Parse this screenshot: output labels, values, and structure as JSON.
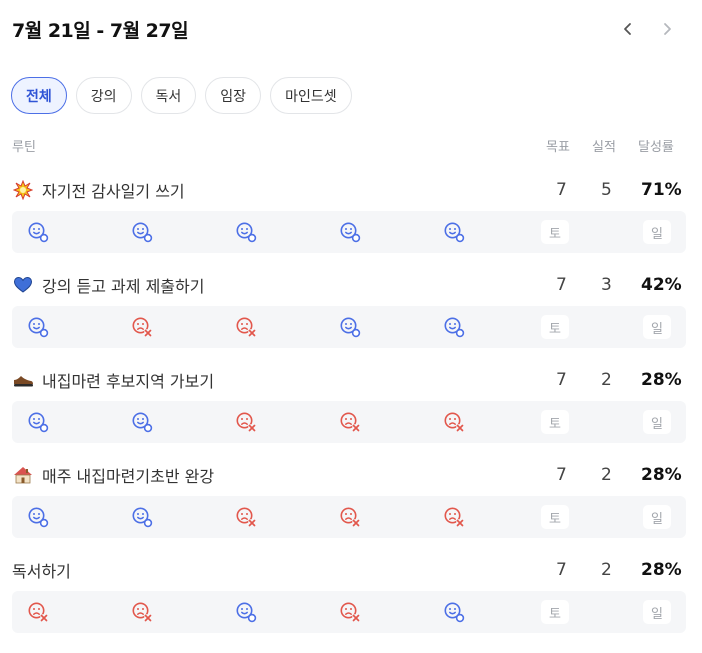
{
  "header": {
    "title": "7월 21일 - 7월 27일"
  },
  "tabs": [
    {
      "label": "전체",
      "active": true
    },
    {
      "label": "강의",
      "active": false
    },
    {
      "label": "독서",
      "active": false
    },
    {
      "label": "임장",
      "active": false
    },
    {
      "label": "마인드셋",
      "active": false
    }
  ],
  "columns": {
    "routine": "루틴",
    "goal": "목표",
    "actual": "실적",
    "rate": "달성률"
  },
  "colors": {
    "done": "#4c6fe6",
    "missed": "#e2574c",
    "accent": "#4c6fe6"
  },
  "routines": [
    {
      "icon": "explosion-icon",
      "title": "자기전 감사일기 쓰기",
      "goal": "7",
      "actual": "5",
      "rate": "71%",
      "days": [
        "done",
        "done",
        "done",
        "done",
        "done"
      ],
      "sat": "토",
      "sun": "일"
    },
    {
      "icon": "blue-heart-icon",
      "title": "강의 듣고 과제 제출하기",
      "goal": "7",
      "actual": "3",
      "rate": "42%",
      "days": [
        "done",
        "missed",
        "missed",
        "done",
        "done"
      ],
      "sat": "토",
      "sun": "일"
    },
    {
      "icon": "shoe-icon",
      "title": "내집마련 후보지역 가보기",
      "goal": "7",
      "actual": "2",
      "rate": "28%",
      "days": [
        "done",
        "done",
        "missed",
        "missed",
        "missed"
      ],
      "sat": "토",
      "sun": "일"
    },
    {
      "icon": "house-icon",
      "title": "매주 내집마련기초반 완강",
      "goal": "7",
      "actual": "2",
      "rate": "28%",
      "days": [
        "done",
        "done",
        "missed",
        "missed",
        "missed"
      ],
      "sat": "토",
      "sun": "일"
    },
    {
      "icon": "",
      "title": "독서하기",
      "goal": "7",
      "actual": "2",
      "rate": "28%",
      "days": [
        "missed",
        "missed",
        "done",
        "missed",
        "done"
      ],
      "sat": "토",
      "sun": "일"
    }
  ]
}
